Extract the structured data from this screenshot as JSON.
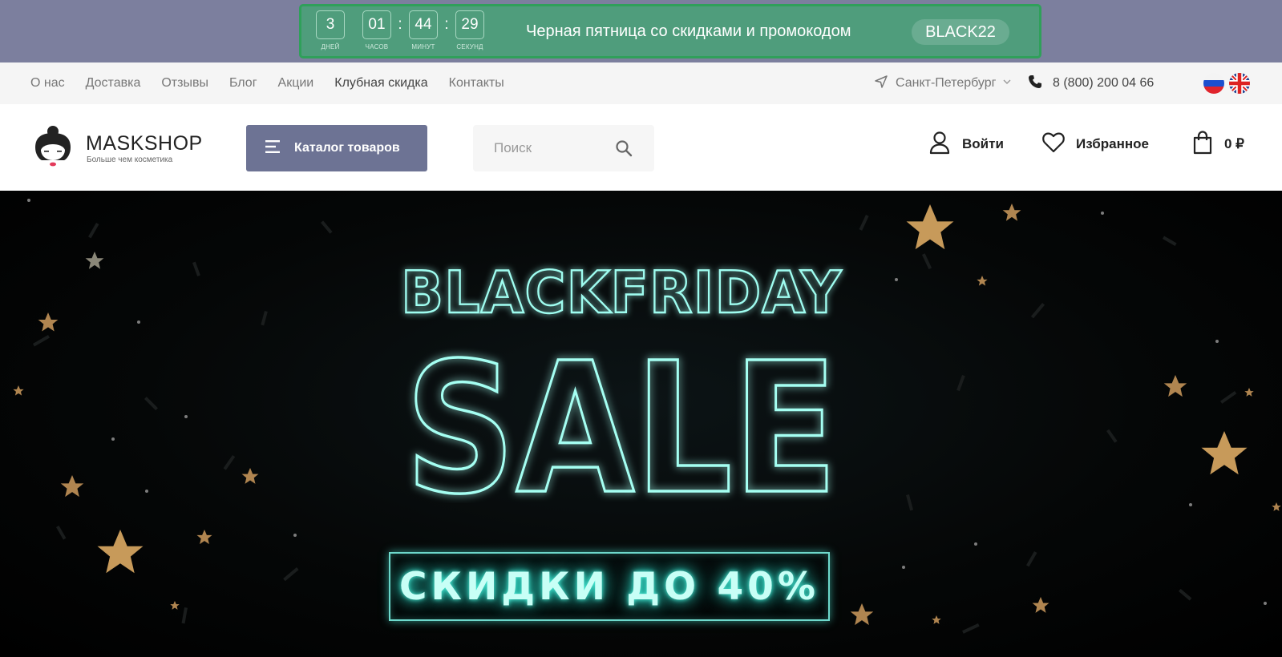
{
  "promo": {
    "timer": [
      {
        "value": "3",
        "label": "дней"
      },
      {
        "value": "01",
        "label": "часов"
      },
      {
        "value": "44",
        "label": "минут"
      },
      {
        "value": "29",
        "label": "секунд"
      }
    ],
    "separator": ":",
    "text": "Черная пятница со скидками и промокодом",
    "code": "BLACK22"
  },
  "topnav": {
    "links": [
      "О нас",
      "Доставка",
      "Отзывы",
      "Блог",
      "Акции",
      "Клубная скидка",
      "Контакты"
    ],
    "city": "Санкт-Петербург",
    "phone": "8 (800) 200 04 66"
  },
  "header": {
    "logo_name": "MASKSHOP",
    "logo_tagline": "Больше чем косметика",
    "catalog_label": "Каталог товаров",
    "search_placeholder": "Поиск",
    "login_label": "Войти",
    "favorites_label": "Избранное",
    "cart_label": "0 ₽"
  },
  "banner": {
    "line1": "BLACKFRIDAY",
    "line2": "SALE",
    "line3": "СКИДКИ ДО 40%"
  },
  "colors": {
    "promo_bg": "#7c7f9e",
    "promo_box": "#4f9d7c",
    "catalog_btn": "#6d7394",
    "neon": "#4ff3dd",
    "star": "#c79a5a"
  },
  "icons": [
    "hamburger-icon",
    "search-icon",
    "user-icon",
    "heart-icon",
    "bag-icon",
    "location-arrow-icon",
    "phone-icon",
    "chevron-down-icon",
    "flag-ru-icon",
    "flag-uk-icon",
    "star-icon"
  ]
}
